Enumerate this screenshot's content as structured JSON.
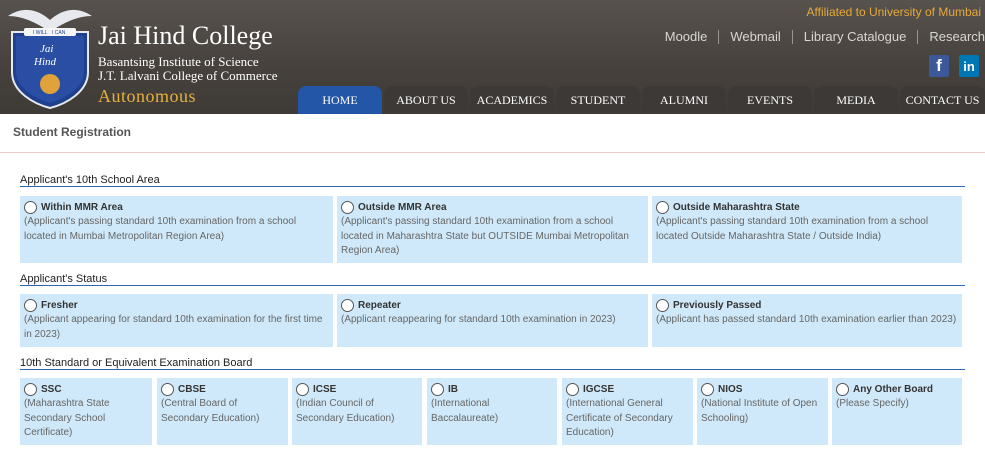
{
  "header": {
    "college_name": "Jai Hind College",
    "sub1": "Basantsing Institute of Science",
    "sub2": "J.T. Lalvani College of Commerce",
    "autonomous": "Autonomous",
    "affiliated": "Affiliated to University of Mumbai",
    "logo_motto": "I WILL",
    "logo_motto2": "I CAN",
    "logo_text1": "Jai",
    "logo_text2": "Hind",
    "toplinks": [
      "Moodle",
      "Webmail",
      "Library Catalogue",
      "Research"
    ],
    "social": {
      "facebook": "f",
      "linkedin": "in"
    }
  },
  "nav": {
    "tabs": [
      "HOME",
      "ABOUT US",
      "ACADEMICS",
      "STUDENT",
      "ALUMNI",
      "EVENTS",
      "MEDIA",
      "CONTACT US"
    ]
  },
  "page": {
    "title": "Student Registration"
  },
  "sections": {
    "area": {
      "label": "Applicant's 10th School Area",
      "options": [
        {
          "title": "Within MMR Area",
          "desc": "(Applicant's passing standard 10th examination from a school located in Mumbai Metropolitan Region Area)"
        },
        {
          "title": "Outside MMR Area",
          "desc": "(Applicant's passing standard 10th examination from a school located in Maharashtra State but OUTSIDE Mumbai Metropolitan Region Area)"
        },
        {
          "title": "Outside Maharashtra State",
          "desc": "(Applicant's passing standard 10th examination from a school located Outside Maharashtra State / Outside India)"
        }
      ]
    },
    "status": {
      "label": "Applicant's Status",
      "options": [
        {
          "title": "Fresher",
          "desc": "(Applicant appearing for standard 10th examination for the first time in 2023)"
        },
        {
          "title": "Repeater",
          "desc": "(Applicant reappearing for standard 10th examination in 2023)"
        },
        {
          "title": "Previously Passed",
          "desc": "(Applicant has passed standard 10th examination earlier than 2023)"
        }
      ]
    },
    "board": {
      "label": "10th Standard or Equivalent Examination Board",
      "options": [
        {
          "title": "SSC",
          "desc": "(Maharashtra State Secondary School Certificate)"
        },
        {
          "title": "CBSE",
          "desc": "(Central Board of Secondary Education)"
        },
        {
          "title": "ICSE",
          "desc": "(Indian Council of Secondary Education)"
        },
        {
          "title": "IB",
          "desc": "(International Baccalaureate)"
        },
        {
          "title": "IGCSE",
          "desc": "(International General Certificate of Secondary Education)"
        },
        {
          "title": "NIOS",
          "desc": "(National Institute of Open Schooling)"
        },
        {
          "title": "Any Other Board",
          "desc": "(Please Specify)"
        }
      ]
    }
  },
  "colors": {
    "header_bg": "#4a4541",
    "accent_gold": "#e6b03c",
    "active_tab": "#2456a8",
    "card_bg": "#cfe9fa",
    "section_rule": "#2d66b5"
  }
}
